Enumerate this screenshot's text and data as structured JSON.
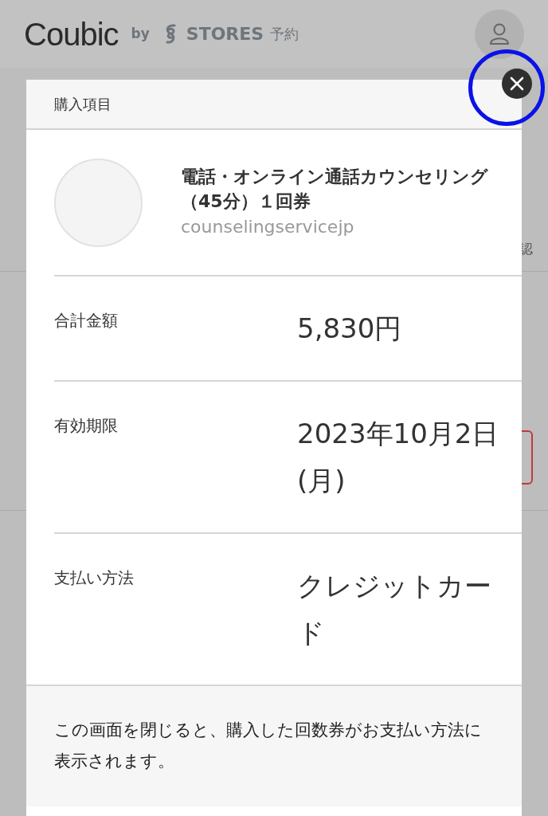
{
  "header": {
    "logo": "Coubic",
    "by": "by",
    "brand": "STORES",
    "brand_suffix": "予約"
  },
  "background": {
    "fragment": "認"
  },
  "modal": {
    "title": "購入項目",
    "product": {
      "name": "電話・オンライン通話カウンセリング（45分）１回券",
      "shop": "counselingservicejp"
    },
    "rows": [
      {
        "label": "合計金額",
        "value": "5,830円"
      },
      {
        "label": "有効期限",
        "value": "2023年10月2日(月)"
      },
      {
        "label": "支払い方法",
        "value": "クレジットカード"
      }
    ],
    "note": "この画面を閉じると、購入した回数券がお支払い方法に表示されます。"
  }
}
